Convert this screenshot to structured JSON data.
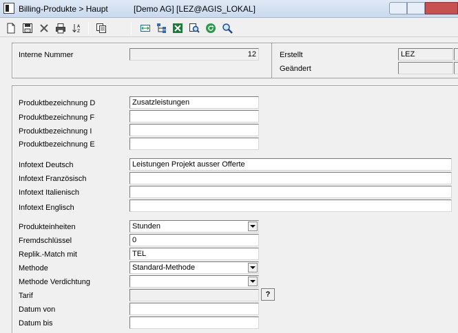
{
  "window": {
    "title": "Billing-Produkte > Haupt",
    "context": "[Demo AG] [LEZ@AGIS_LOKAL]"
  },
  "toolbar": {
    "icons": [
      "new-icon",
      "save-icon",
      "delete-icon",
      "print-icon",
      "sort-icon",
      "copy-icon",
      "expand-icon",
      "tree-icon",
      "excel-icon",
      "find-icon",
      "refresh-icon",
      "search-icon"
    ]
  },
  "header": {
    "interne_nummer_label": "Interne Nummer",
    "interne_nummer_value": "12",
    "erstellt_label": "Erstellt",
    "erstellt_value": "LEZ",
    "geaendert_label": "Geändert",
    "geaendert_value": ""
  },
  "form": {
    "produktbezeichnung_d_label": "Produktbezeichnung D",
    "produktbezeichnung_d_value": "Zusatzleistungen",
    "produktbezeichnung_f_label": "Produktbezeichnung F",
    "produktbezeichnung_f_value": "",
    "produktbezeichnung_i_label": "Produktbezeichnung I",
    "produktbezeichnung_i_value": "",
    "produktbezeichnung_e_label": "Produktbezeichnung E",
    "produktbezeichnung_e_value": "",
    "infotext_deutsch_label": "Infotext Deutsch",
    "infotext_deutsch_value": "Leistungen Projekt ausser Offerte",
    "infotext_franzoesisch_label": "Infotext Französisch",
    "infotext_franzoesisch_value": "",
    "infotext_italienisch_label": "Infotext Italienisch",
    "infotext_italienisch_value": "",
    "infotext_englisch_label": "Infotext Englisch",
    "infotext_englisch_value": "",
    "produkteinheiten_label": "Produkteinheiten",
    "produkteinheiten_value": "Stunden",
    "fremdschluessel_label": "Fremdschlüssel",
    "fremdschluessel_value": "0",
    "replik_match_label": "Replik.-Match mit",
    "replik_match_value": "TEL",
    "methode_label": "Methode",
    "methode_value": "Standard-Methode",
    "methode_verdichtung_label": "Methode Verdichtung",
    "methode_verdichtung_value": "",
    "tarif_label": "Tarif",
    "tarif_value": "",
    "tarif_button": "?",
    "datum_von_label": "Datum von",
    "datum_von_value": "",
    "datum_bis_label": "Datum bis",
    "datum_bis_value": ""
  }
}
